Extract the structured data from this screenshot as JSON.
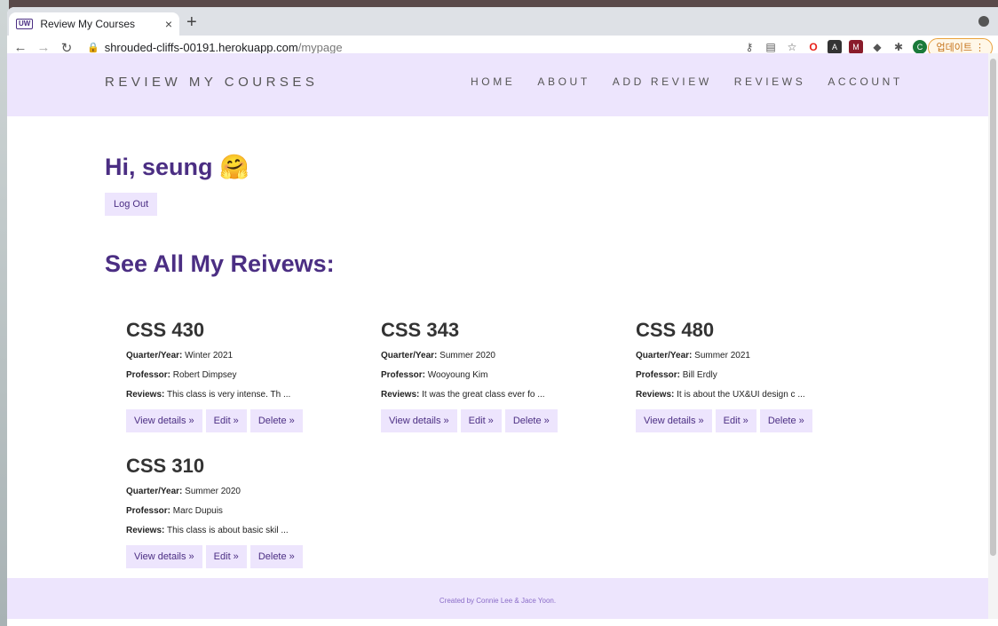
{
  "browser": {
    "tab_title": "Review My Courses",
    "favicon_text": "UW",
    "tab_close": "×",
    "new_tab": "+",
    "url_host": "shrouded-cliffs-00191.herokuapp.com",
    "url_path": "/mypage",
    "update_label": "업데이트"
  },
  "site": {
    "brand": "REVIEW MY COURSES",
    "nav": [
      "HOME",
      "ABOUT",
      "ADD REVIEW",
      "REVIEWS",
      "ACCOUNT"
    ],
    "greeting": "Hi, seung 🤗",
    "logout_label": "Log Out",
    "section_title": "See All My Reivews:",
    "footer": "Created by Connie Lee & Jace Yoon."
  },
  "labels": {
    "quarter": "Quarter/Year:",
    "professor": "Professor:",
    "reviews": "Reviews:",
    "view": "View details »",
    "edit": "Edit »",
    "delete": "Delete »"
  },
  "courses": [
    {
      "code": "CSS 430",
      "quarter": "Winter 2021",
      "professor": "Robert Dimpsey",
      "review": "This class is very intense. Th ..."
    },
    {
      "code": "CSS 343",
      "quarter": "Summer 2020",
      "professor": "Wooyoung Kim",
      "review": "It was the great class ever fo ..."
    },
    {
      "code": "CSS 480",
      "quarter": "Summer 2021",
      "professor": "Bill Erdly",
      "review": "It is about the UX&UI design c ..."
    },
    {
      "code": "CSS 310",
      "quarter": "Summer 2020",
      "professor": "Marc Dupuis",
      "review": "This class is about basic skil ..."
    }
  ]
}
